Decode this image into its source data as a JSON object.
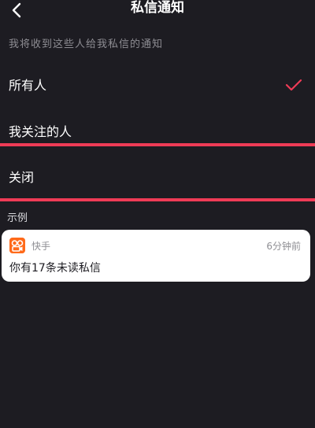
{
  "header": {
    "title": "私信通知"
  },
  "subtitle": "我将收到这些人给我私信的通知",
  "options": [
    {
      "label": "所有人",
      "selected": true
    },
    {
      "label": "我关注的人",
      "selected": false
    },
    {
      "label": "关闭",
      "selected": false
    }
  ],
  "example": {
    "section_label": "示例",
    "app_name": "快手",
    "time": "6分钟前",
    "message": "你有17条未读私信"
  },
  "colors": {
    "background": "#1d1c22",
    "accent": "#ef3b56",
    "app_icon": "#ff6a1a",
    "card": "#ffffff"
  },
  "icons": {
    "back": "chevron-left-icon",
    "selected": "checkmark-icon",
    "app": "kuaishou-logo-icon"
  }
}
